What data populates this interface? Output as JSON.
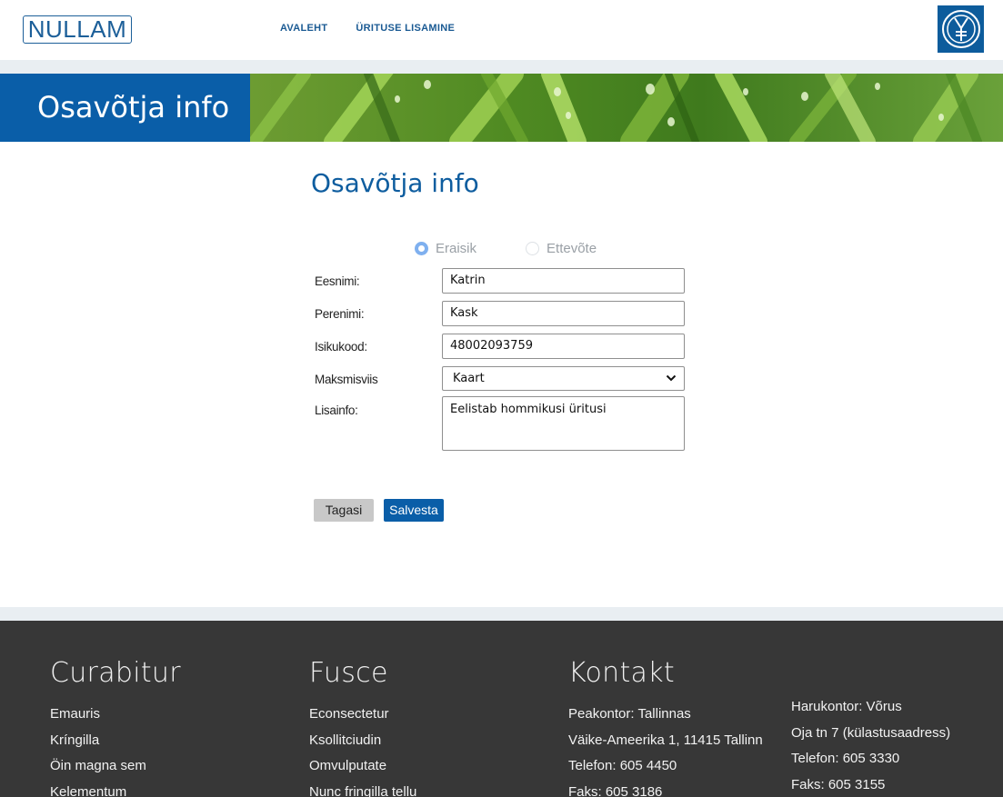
{
  "header": {
    "logo_text": "NULLAM",
    "nav": [
      "AVALEHT",
      "ÜRITUSE LISAMINE"
    ],
    "emblem_icon": "crest-icon"
  },
  "hero": {
    "title": "Osavõtja info",
    "image": "grass-dew-banner"
  },
  "main": {
    "title": "Osavõtja info",
    "radio_options": [
      {
        "label": "Eraisik",
        "checked": true
      },
      {
        "label": "Ettevõte",
        "checked": false
      }
    ],
    "fields": {
      "first_name": {
        "label": "Eesnimi:",
        "value": "Katrin"
      },
      "last_name": {
        "label": "Perenimi:",
        "value": "Kask"
      },
      "id_code": {
        "label": "Isikukood:",
        "value": "48002093759"
      },
      "payment": {
        "label": "Maksmisviis",
        "value": "Kaart"
      },
      "info": {
        "label": "Lisainfo:",
        "value": "Eelistab hommikusi üritusi"
      }
    },
    "buttons": {
      "back": "Tagasi",
      "save": "Salvesta"
    }
  },
  "footer": {
    "col1": {
      "title": "Curabitur",
      "items": [
        "Emauris",
        "Kríngilla",
        "Öin magna sem",
        "Kelementum"
      ]
    },
    "col2": {
      "title": "Fusce",
      "items": [
        "Econsectetur",
        "Ksollitciudin",
        "Omvulputate",
        "Nunc fringilla tellu"
      ]
    },
    "contact": {
      "title": "Kontakt",
      "main_office": [
        "Peakontor: Tallinnas",
        "Väike-Ameerika 1, 11415 Tallinn",
        "Telefon: 605 4450",
        "Faks: 605 3186"
      ],
      "branch_office": [
        "Harukontor: Võrus",
        "Oja tn 7 (külastusaadress)",
        "Telefon: 605 3330",
        "Faks: 605 3155"
      ]
    }
  },
  "colors": {
    "brand_blue": "#0a5ea8",
    "footer_bg": "#373737",
    "band": "#e9eef2"
  }
}
